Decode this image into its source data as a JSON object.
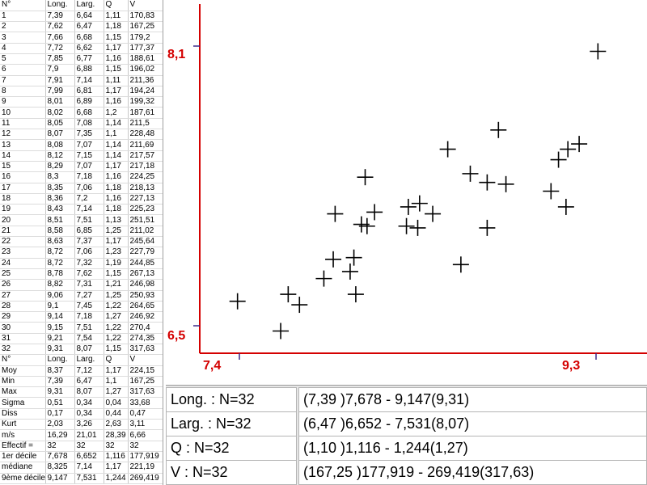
{
  "table": {
    "headers": [
      "N°",
      "Long.",
      "Larg.",
      "Q",
      "V"
    ],
    "rows": [
      [
        "1",
        "7,39",
        "6,64",
        "1,11",
        "170,83"
      ],
      [
        "2",
        "7,62",
        "6,47",
        "1,18",
        "167,25"
      ],
      [
        "3",
        "7,66",
        "6,68",
        "1,15",
        "179,2"
      ],
      [
        "4",
        "7,72",
        "6,62",
        "1,17",
        "177,37"
      ],
      [
        "5",
        "7,85",
        "6,77",
        "1,16",
        "188,61"
      ],
      [
        "6",
        "7,9",
        "6,88",
        "1,15",
        "196,02"
      ],
      [
        "7",
        "7,91",
        "7,14",
        "1,11",
        "211,36"
      ],
      [
        "8",
        "7,99",
        "6,81",
        "1,17",
        "194,24"
      ],
      [
        "9",
        "8,01",
        "6,89",
        "1,16",
        "199,32"
      ],
      [
        "10",
        "8,02",
        "6,68",
        "1,2",
        "187,61"
      ],
      [
        "11",
        "8,05",
        "7,08",
        "1,14",
        "211,5"
      ],
      [
        "12",
        "8,07",
        "7,35",
        "1,1",
        "228,48"
      ],
      [
        "13",
        "8,08",
        "7,07",
        "1,14",
        "211,69"
      ],
      [
        "14",
        "8,12",
        "7,15",
        "1,14",
        "217,57"
      ],
      [
        "15",
        "8,29",
        "7,07",
        "1,17",
        "217,18"
      ],
      [
        "16",
        "8,3",
        "7,18",
        "1,16",
        "224,25"
      ],
      [
        "17",
        "8,35",
        "7,06",
        "1,18",
        "218,13"
      ],
      [
        "18",
        "8,36",
        "7,2",
        "1,16",
        "227,13"
      ],
      [
        "19",
        "8,43",
        "7,14",
        "1,18",
        "225,23"
      ],
      [
        "20",
        "8,51",
        "7,51",
        "1,13",
        "251,51"
      ],
      [
        "21",
        "8,58",
        "6,85",
        "1,25",
        "211,02"
      ],
      [
        "22",
        "8,63",
        "7,37",
        "1,17",
        "245,64"
      ],
      [
        "23",
        "8,72",
        "7,06",
        "1,23",
        "227,79"
      ],
      [
        "24",
        "8,72",
        "7,32",
        "1,19",
        "244,85"
      ],
      [
        "25",
        "8,78",
        "7,62",
        "1,15",
        "267,13"
      ],
      [
        "26",
        "8,82",
        "7,31",
        "1,21",
        "246,98"
      ],
      [
        "27",
        "9,06",
        "7,27",
        "1,25",
        "250,93"
      ],
      [
        "28",
        "9,1",
        "7,45",
        "1,22",
        "264,65"
      ],
      [
        "29",
        "9,14",
        "7,18",
        "1,27",
        "246,92"
      ],
      [
        "30",
        "9,15",
        "7,51",
        "1,22",
        "270,4"
      ],
      [
        "31",
        "9,21",
        "7,54",
        "1,22",
        "274,35"
      ],
      [
        "32",
        "9,31",
        "8,07",
        "1,15",
        "317,63"
      ]
    ],
    "stats_headers": [
      "N°",
      "Long.",
      "Larg.",
      "Q",
      "V"
    ],
    "stats": [
      [
        "Moy",
        "8,37",
        "7,12",
        "1,17",
        "224,15"
      ],
      [
        "Min",
        "7,39",
        "6,47",
        "1,1",
        "167,25"
      ],
      [
        "Max",
        "9,31",
        "8,07",
        "1,27",
        "317,63"
      ],
      [
        "Sigma",
        "0,51",
        "0,34",
        "0,04",
        "33,68"
      ],
      [
        "Diss",
        "0,17",
        "0,34",
        "0,44",
        "0,47"
      ],
      [
        "Kurt",
        "2,03",
        "3,26",
        "2,63",
        "3,11"
      ],
      [
        "m/s",
        "16,29",
        "21,01",
        "28,39",
        "6,66"
      ],
      [
        "Effectif =",
        "32",
        "32",
        "32",
        "32"
      ],
      [
        "1er décile",
        "7,678",
        "6,652",
        "1,116",
        "177,919"
      ],
      [
        "médiane",
        "8,325",
        "7,14",
        "1,17",
        "221,19"
      ],
      [
        "9ème décile",
        "9,147",
        "7,531",
        "1,244",
        "269,419"
      ]
    ]
  },
  "summary": [
    {
      "label": "Long. : N=32",
      "range": "(7,39 )7,678 - 9,147(9,31)"
    },
    {
      "label": "Larg. : N=32",
      "range": "(6,47 )6,652 - 7,531(8,07)"
    },
    {
      "label": "Q : N=32",
      "range": "(1,10 )1,116 - 1,244(1,27)"
    },
    {
      "label": "V : N=32",
      "range": "(167,25 )177,919 - 269,419(317,63)"
    }
  ],
  "chart_data": {
    "type": "scatter",
    "xlabel": "",
    "ylabel": "",
    "xlim": [
      7.4,
      9.3
    ],
    "ylim": [
      6.5,
      8.1
    ],
    "x_tick_labels": [
      "7,4",
      "9,3"
    ],
    "y_tick_labels": [
      "8,1",
      "6,5"
    ],
    "axis_color": "#d40000",
    "tick_color": "#3a2a8a",
    "marker": "plus",
    "points": [
      [
        7.39,
        6.64
      ],
      [
        7.62,
        6.47
      ],
      [
        7.66,
        6.68
      ],
      [
        7.72,
        6.62
      ],
      [
        7.85,
        6.77
      ],
      [
        7.9,
        6.88
      ],
      [
        7.91,
        7.14
      ],
      [
        7.99,
        6.81
      ],
      [
        8.01,
        6.89
      ],
      [
        8.02,
        6.68
      ],
      [
        8.05,
        7.08
      ],
      [
        8.07,
        7.35
      ],
      [
        8.08,
        7.07
      ],
      [
        8.12,
        7.15
      ],
      [
        8.29,
        7.07
      ],
      [
        8.3,
        7.18
      ],
      [
        8.35,
        7.06
      ],
      [
        8.36,
        7.2
      ],
      [
        8.43,
        7.14
      ],
      [
        8.51,
        7.51
      ],
      [
        8.58,
        6.85
      ],
      [
        8.63,
        7.37
      ],
      [
        8.72,
        7.06
      ],
      [
        8.72,
        7.32
      ],
      [
        8.78,
        7.62
      ],
      [
        8.82,
        7.31
      ],
      [
        9.06,
        7.27
      ],
      [
        9.1,
        7.45
      ],
      [
        9.14,
        7.18
      ],
      [
        9.15,
        7.51
      ],
      [
        9.21,
        7.54
      ],
      [
        9.31,
        8.07
      ]
    ]
  }
}
